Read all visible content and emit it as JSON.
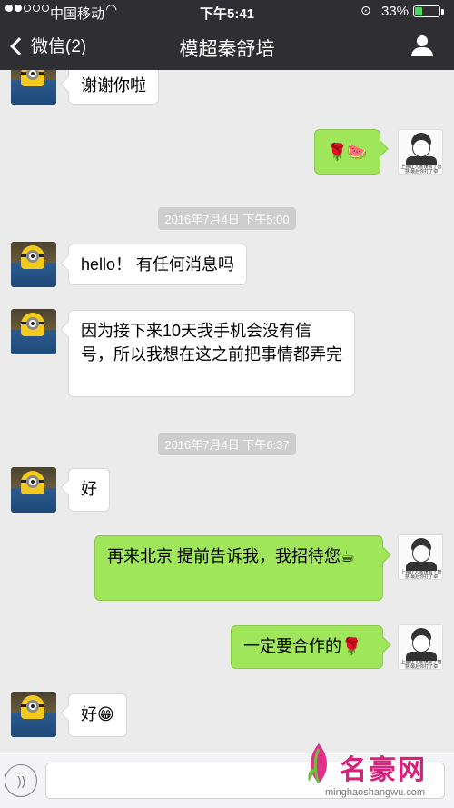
{
  "status_bar": {
    "carrier": "中国移动",
    "time": "下午5:41",
    "battery_percent": "33%",
    "battery_level": 0.33,
    "signal_bars_filled": 2,
    "signal_bars_total": 5
  },
  "nav": {
    "back_label": "微信(2)",
    "title": "模超秦舒培"
  },
  "messages": [
    {
      "side": "in",
      "text": "谢谢你啦"
    },
    {
      "side": "out",
      "text": "🌹🍉"
    },
    {
      "type": "timestamp",
      "text": "2016年7月4日 下午5:00"
    },
    {
      "side": "in",
      "text": "hello！ 有任何消息吗"
    },
    {
      "side": "in",
      "text": "因为接下来10天我手机会没有信号，所以我想在这之前把事情都弄完"
    },
    {
      "type": "timestamp",
      "text": "2016年7月4日 下午6:37"
    },
    {
      "side": "in",
      "text": "好"
    },
    {
      "side": "out",
      "text": "再来北京 提前告诉我，我招待您☕"
    },
    {
      "side": "out",
      "text": "一定要合作的🌹"
    },
    {
      "side": "in",
      "text": "好😁"
    }
  ],
  "my_avatar_caption": "上帝让人间误会了智慧 最后你打了卓",
  "watermark": {
    "brand": "名豪网",
    "url": "minghaoshangwu.com"
  },
  "colors": {
    "header_bg": "#2e2e33",
    "chat_bg": "#ebebeb",
    "outgoing_bubble": "#9fe65a",
    "incoming_bubble": "#ffffff",
    "watermark_brand": "#d9207b"
  }
}
